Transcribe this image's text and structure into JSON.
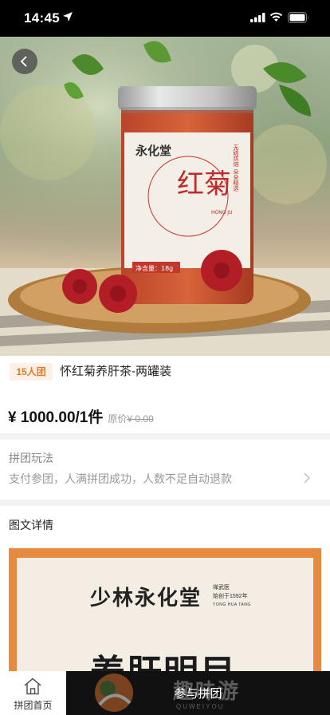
{
  "status_bar": {
    "time": "14:45"
  },
  "product_image": {
    "brand": "永化堂",
    "name": "红菊",
    "vertical_text": "无硫烘焙 朵朵精选",
    "pinyin": "HONG JU",
    "net_weight": "净含量：18g"
  },
  "product": {
    "group_badge": "15人团",
    "title": "怀红菊养肝茶-两罐装",
    "price": "¥ 1000.00",
    "unit": "/1件",
    "original_price_label": "原价",
    "original_price": "¥ 0.00"
  },
  "rules": {
    "title": "拼团玩法",
    "description": "支付参团，人满拼团成功，人数不足自动退款"
  },
  "detail": {
    "title": "图文详情",
    "brand_logo": "少林永化堂",
    "brand_line1": "禅武医",
    "brand_line2": "始创于1592年",
    "brand_en": "YONG HUA TANG",
    "slogan": "养肝明目"
  },
  "bottom_bar": {
    "home_label": "拼团首页",
    "join_label": "参与拼团"
  },
  "watermark": {
    "text": "趣味游",
    "sub": "QUWEIYOU"
  },
  "colors": {
    "accent": "#e07a2e",
    "badge_bg": "#fdf0e6",
    "join_bg": "#111111"
  }
}
